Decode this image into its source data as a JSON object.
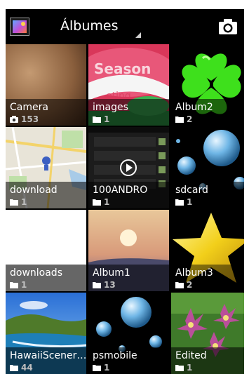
{
  "header": {
    "title": "Álbumes",
    "app_icon": "gallery-icon",
    "camera_icon": "camera-icon"
  },
  "albums": [
    {
      "name": "Camera",
      "count": "153",
      "icon": "camera-icon"
    },
    {
      "name": "images",
      "count": "1",
      "icon": "folder-icon"
    },
    {
      "name": "Album2",
      "count": "2",
      "icon": "folder-icon"
    },
    {
      "name": "download",
      "count": "1",
      "icon": "folder-icon"
    },
    {
      "name": "100ANDRO",
      "count": "1",
      "icon": "folder-icon"
    },
    {
      "name": "sdcard",
      "count": "1",
      "icon": "folder-icon"
    },
    {
      "name": "downloads",
      "count": "1",
      "icon": "folder-icon"
    },
    {
      "name": "Album1",
      "count": "13",
      "icon": "folder-icon"
    },
    {
      "name": "Album3",
      "count": "2",
      "icon": "folder-icon"
    },
    {
      "name": "HawaiiScener…",
      "count": "44",
      "icon": "folder-icon"
    },
    {
      "name": "psmobile",
      "count": "1",
      "icon": "folder-icon"
    },
    {
      "name": "Edited",
      "count": "1",
      "icon": "folder-icon"
    }
  ]
}
